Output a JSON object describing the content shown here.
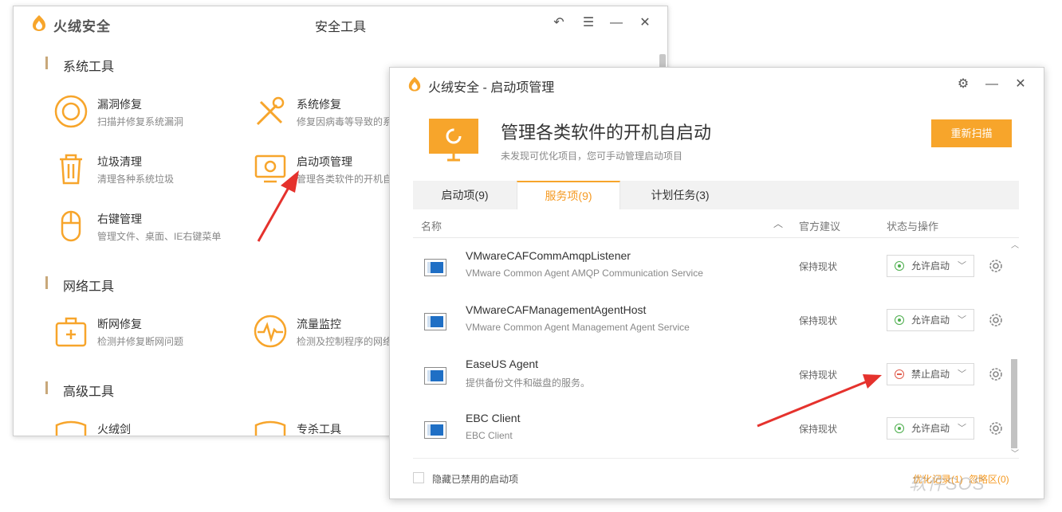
{
  "back_window": {
    "brand": "火绒安全",
    "title": "安全工具",
    "sections": [
      {
        "heading": "系统工具"
      },
      {
        "heading": "网络工具"
      },
      {
        "heading": "高级工具"
      }
    ],
    "tools": [
      {
        "name": "漏洞修复",
        "desc": "扫描并修复系统漏洞",
        "icon": "vulnerability-icon"
      },
      {
        "name": "系统修复",
        "desc": "修复因病毒等导致的系",
        "icon": "wrench-screwdriver-icon"
      },
      {
        "name": "垃圾清理",
        "desc": "清理各种系统垃圾",
        "icon": "trash-icon"
      },
      {
        "name": "启动项管理",
        "desc": "管理各类软件的开机自",
        "icon": "startup-monitor-icon"
      },
      {
        "name": "右键管理",
        "desc": "管理文件、桌面、IE右键菜单",
        "icon": "mouse-icon"
      },
      {
        "name": "断网修复",
        "desc": "检测并修复断网问题",
        "icon": "medkit-icon"
      },
      {
        "name": "流量监控",
        "desc": "检测及控制程序的网络",
        "icon": "pulse-icon"
      },
      {
        "name": "火绒剑",
        "desc": "",
        "icon": "shield-icon"
      },
      {
        "name": "专杀工具",
        "desc": "",
        "icon": "shield-icon"
      }
    ]
  },
  "front_window": {
    "title": "火绒安全 - 启动项管理",
    "hero_title": "管理各类软件的开机自启动",
    "hero_sub": "未发现可优化项目，您可手动管理启动项目",
    "rescan": "重新扫描",
    "tabs": [
      {
        "label": "启动项(9)",
        "active": false
      },
      {
        "label": "服务项(9)",
        "active": true
      },
      {
        "label": "计划任务(3)",
        "active": false
      }
    ],
    "columns": {
      "name": "名称",
      "advice": "官方建议",
      "status": "状态与操作"
    },
    "rows": [
      {
        "name": "VMwareCAFCommAmqpListener",
        "desc": "VMware Common Agent AMQP Communication Service",
        "advice": "保持现状",
        "status": "允许启动",
        "enabled": true
      },
      {
        "name": "VMwareCAFManagementAgentHost",
        "desc": "VMware Common Agent Management Agent Service",
        "advice": "保持现状",
        "status": "允许启动",
        "enabled": true
      },
      {
        "name": "EaseUS Agent",
        "desc": "提供备份文件和磁盘的服务。",
        "advice": "保持现状",
        "status": "禁止启动",
        "enabled": false
      },
      {
        "name": "EBC Client",
        "desc": "EBC Client",
        "advice": "保持现状",
        "status": "允许启动",
        "enabled": true
      }
    ],
    "footer": {
      "hide_disabled": "隐藏已禁用的启动项",
      "opt_record": "优化记录(1)",
      "ignore_zone": "忽略区(0)"
    }
  },
  "watermark": "软件SOS",
  "colors": {
    "accent": "#f7a52b",
    "tab_active_text": "#f59a23",
    "enabled": "#4cae4c",
    "disabled": "#e05a4a",
    "arrow": "#e5322d"
  }
}
